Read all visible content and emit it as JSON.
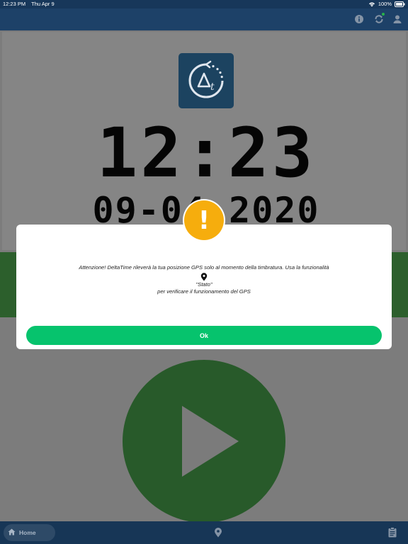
{
  "status_bar": {
    "time": "12:23 PM",
    "date": "Thu Apr 9",
    "battery": "100%"
  },
  "top_bar": {
    "icons": [
      "info-icon",
      "sync-icon",
      "user-icon"
    ]
  },
  "clock": {
    "time": "12:23",
    "date": "09-04-2020"
  },
  "dialog": {
    "message": "Attenzione! DeltaTime rileverà la tua posizione GPS solo al momento della timbratura. Usa la funzionalità",
    "feature_name": "\"Stato\"",
    "message_end": "per verificare il funzionamento del GPS",
    "ok_label": "Ok",
    "alert_symbol": "!"
  },
  "bottom_nav": {
    "home_label": "Home",
    "icons": [
      "home-icon",
      "location-icon",
      "clipboard-icon"
    ]
  },
  "colors": {
    "header": "#1d4168",
    "ok_button": "#06c36d",
    "alert": "#f6ad0d",
    "play_button": "#285a2a"
  }
}
